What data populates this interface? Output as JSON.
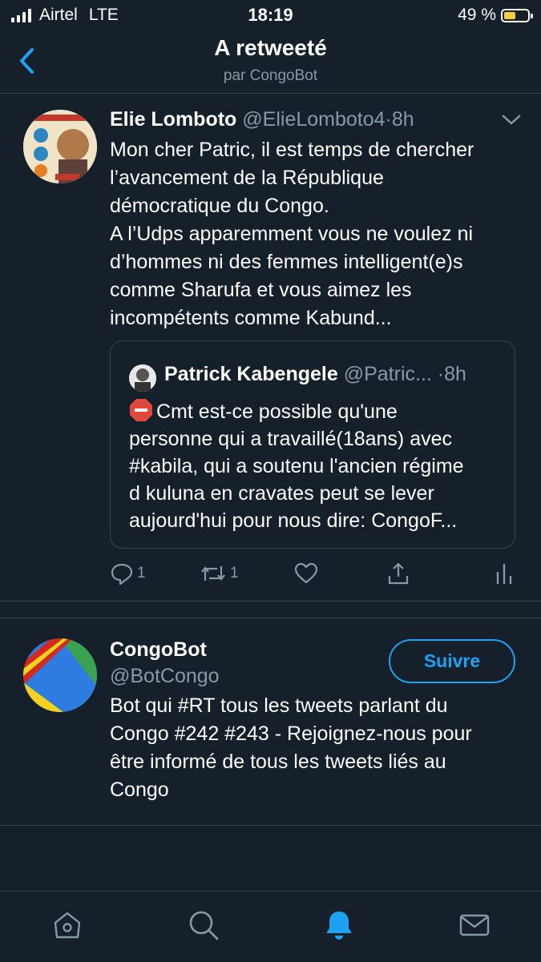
{
  "status_bar": {
    "carrier": "Airtel",
    "network": "LTE",
    "time": "18:19",
    "battery": "49 %",
    "battery_level": 0.49
  },
  "header": {
    "title": "A retweeté",
    "subtitle": "par CongoBot",
    "back_icon": "chevron-left-icon"
  },
  "tweet": {
    "author_name": "Elie Lomboto",
    "author_handle": "@ElieLomboto4",
    "sep": "·",
    "time": "8h",
    "text": "Mon cher Patric, il est temps de chercher\nl’avancement de la République\ndémocratique du Congo.\nA l’Udps apparemment vous ne voulez ni\nd’hommes ni des femmes intelligent(e)s\ncomme Sharufa et vous aimez les\nincompétents comme Kabund...",
    "quote": {
      "author_name": "Patrick Kabengele",
      "author_handle": "@Patric...",
      "sep": "·",
      "time": "8h",
      "text": "Cmt est-ce possible qu'une\npersonne qui a travaillé(18ans) avec\n#kabila, qui a soutenu l'ancien régime\nd kuluna en cravates peut se lever\naujourd'hui pour nous dire: CongoF..."
    },
    "actions": {
      "reply_count": "1",
      "retweet_count": "1"
    }
  },
  "profile_card": {
    "name": "CongoBot",
    "handle": "@BotCongo",
    "follow_label": "Suivre",
    "bio": "Bot qui #RT tous les tweets parlant du\nCongo #242 #243 - Rejoignez-nous pour\nêtre informé de tous les tweets liés au\nCongo"
  },
  "tab_bar": {
    "items": [
      "home-icon",
      "search-icon",
      "notifications-icon",
      "messages-icon"
    ],
    "active": "notifications-icon"
  },
  "colors": {
    "background": "#15202b",
    "accent": "#1da1f2",
    "muted": "#8899a6",
    "border": "#38444d"
  }
}
